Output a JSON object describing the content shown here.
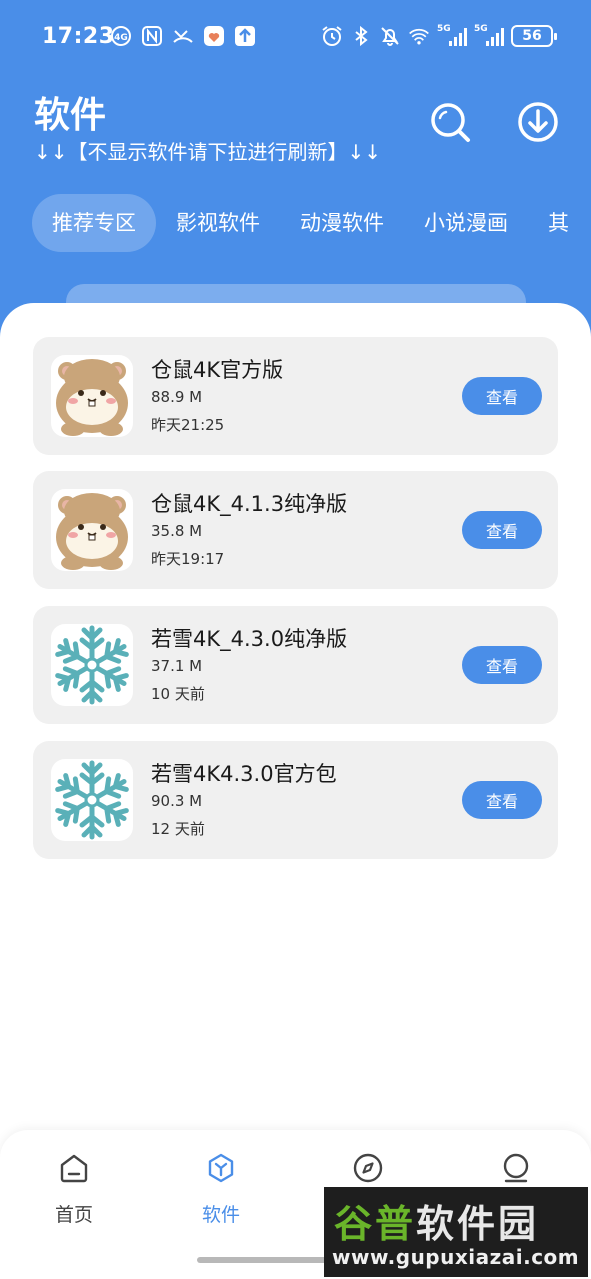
{
  "status_bar": {
    "time": "17:23",
    "network_label_1": "5G",
    "network_label_2": "5G",
    "battery": "56"
  },
  "header": {
    "title": "软件",
    "subtitle": "↓↓【不显示软件请下拉进行刷新】↓↓",
    "search_icon": "search-icon",
    "download_icon": "download-icon"
  },
  "tabs": [
    {
      "label": "推荐专区",
      "active": true
    },
    {
      "label": "影视软件",
      "active": false
    },
    {
      "label": "动漫软件",
      "active": false
    },
    {
      "label": "小说漫画",
      "active": false
    },
    {
      "label": "其",
      "active": false
    }
  ],
  "apps": [
    {
      "name": "仓鼠4K官方版",
      "size": "88.9 M",
      "time": "昨天21:25",
      "icon": "hamster-icon",
      "button": "查看"
    },
    {
      "name": "仓鼠4K_4.1.3纯净版",
      "size": "35.8 M",
      "time": "昨天19:17",
      "icon": "hamster-icon",
      "button": "查看"
    },
    {
      "name": "若雪4K_4.3.0纯净版",
      "size": "37.1 M",
      "time": "10 天前",
      "icon": "snowflake-icon",
      "button": "查看"
    },
    {
      "name": "若雪4K4.3.0官方包",
      "size": "90.3 M",
      "time": "12 天前",
      "icon": "snowflake-icon",
      "button": "查看"
    }
  ],
  "bottom_nav": [
    {
      "label": "首页",
      "icon": "home-icon",
      "active": false
    },
    {
      "label": "软件",
      "icon": "software-icon",
      "active": true
    },
    {
      "label": "",
      "icon": "compass-icon",
      "active": false
    },
    {
      "label": "",
      "icon": "profile-icon",
      "active": false
    }
  ],
  "watermark": {
    "brand_prefix": "谷普",
    "brand_suffix": "软件园",
    "url": "www.gupuxiazai.com"
  },
  "colors": {
    "primary": "#4a8ee8",
    "card_bg": "#f0f0f0",
    "snowflake": "#5ab0b8"
  }
}
